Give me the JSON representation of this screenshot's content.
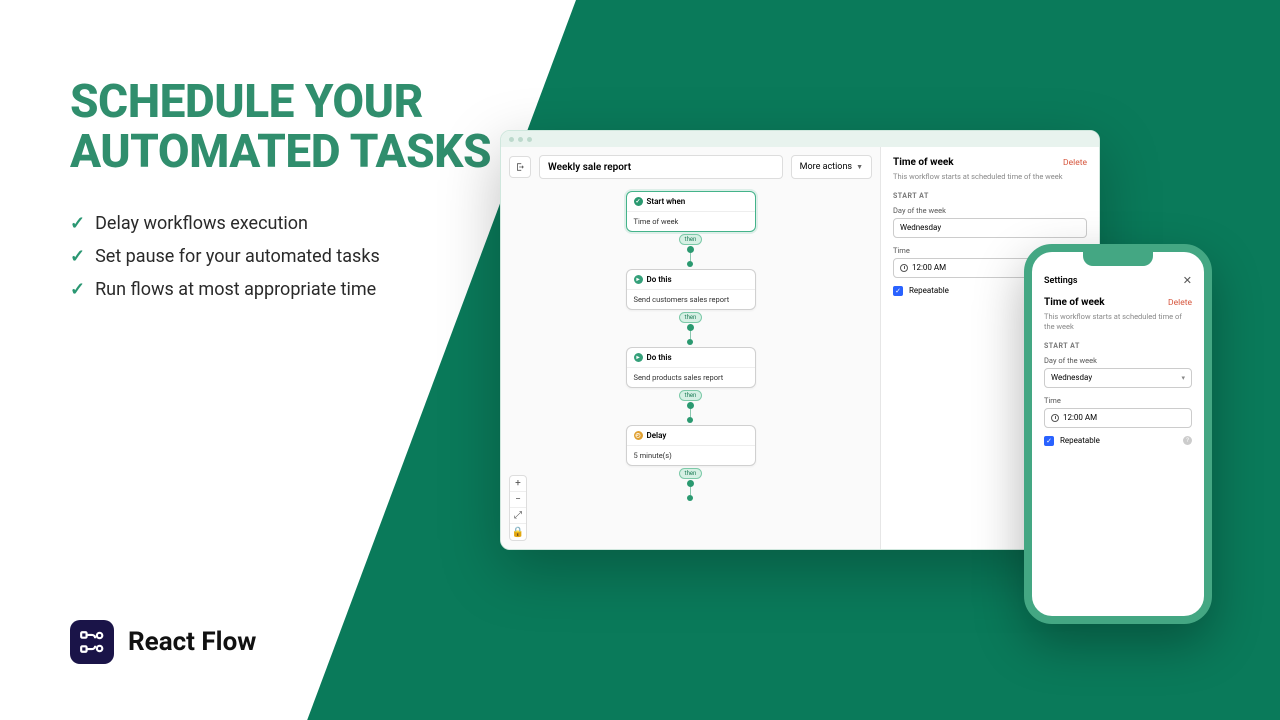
{
  "hero": {
    "title": "SCHEDULE YOUR AUTOMATED TASKS",
    "bullets": [
      "Delay workflows execution",
      "Set pause for your automated tasks",
      "Run flows at most appropriate time"
    ]
  },
  "brand": {
    "name": "React Flow"
  },
  "colors": {
    "primary": "#0a7a5a",
    "heading": "#308e6d",
    "accent": "#2a9970",
    "delete": "#d6553c"
  },
  "desktop": {
    "toolbar": {
      "workflow_title": "Weekly sale report",
      "more_label": "More actions"
    },
    "flow": {
      "nodes": [
        {
          "kind": "start",
          "head": "Start when",
          "body": "Time of week",
          "icon": "check-circle-icon"
        },
        {
          "kind": "action",
          "head": "Do this",
          "body": "Send customers sales report",
          "icon": "play-circle-icon"
        },
        {
          "kind": "action",
          "head": "Do this",
          "body": "Send products sales report",
          "icon": "play-circle-icon"
        },
        {
          "kind": "delay",
          "head": "Delay",
          "body": "5 minute(s)",
          "icon": "clock-icon"
        }
      ],
      "connector_label": "then"
    },
    "sidebar": {
      "title": "Time of week",
      "delete": "Delete",
      "description": "This workflow starts at scheduled time of the week",
      "section": "START AT",
      "day_label": "Day of the week",
      "day_value": "Wednesday",
      "time_label": "Time",
      "time_value": "12:00 AM",
      "repeatable_label": "Repeatable"
    }
  },
  "mobile": {
    "header": "Settings",
    "title": "Time of week",
    "delete": "Delete",
    "description": "This workflow starts at scheduled time of the week",
    "section": "START AT",
    "day_label": "Day of the week",
    "day_value": "Wednesday",
    "time_label": "Time",
    "time_value": "12:00 AM",
    "repeatable_label": "Repeatable"
  }
}
